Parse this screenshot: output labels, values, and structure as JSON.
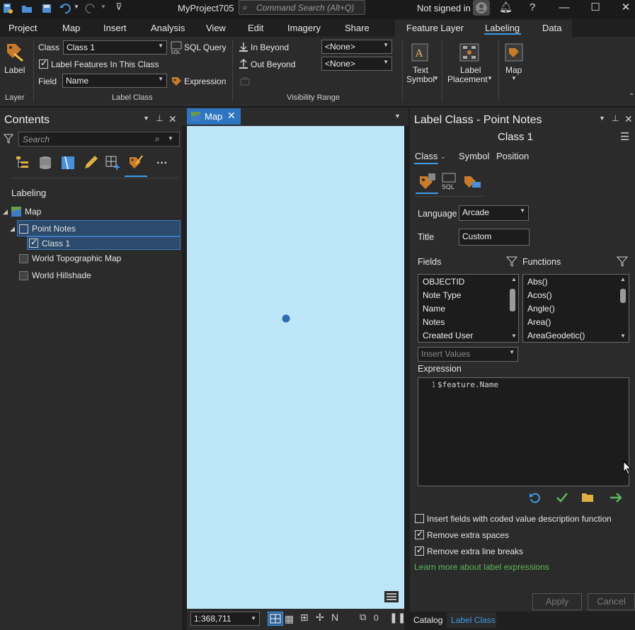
{
  "title_bar": {
    "project_name": "MyProject705",
    "command_search_placeholder": "Command Search (Alt+Q)",
    "sign_in_status": "Not signed in",
    "help_label": "?"
  },
  "menu": {
    "tabs": [
      "Project",
      "Map",
      "Insert",
      "Analysis",
      "View",
      "Edit",
      "Imagery",
      "Share"
    ],
    "contextual_tabs": [
      "Feature Layer",
      "Labeling",
      "Data"
    ],
    "active_tab": "Labeling"
  },
  "ribbon": {
    "layer_group": {
      "label_button": "Label",
      "group_label": "Layer"
    },
    "label_class_group": {
      "class_label": "Class",
      "class_value": "Class 1",
      "sql_query": "SQL Query",
      "label_features_checkbox": "Label Features In This Class",
      "field_label": "Field",
      "field_value": "Name",
      "expression_button": "Expression",
      "group_label": "Label Class"
    },
    "visibility_group": {
      "in_beyond": "In Beyond",
      "out_beyond": "Out Beyond",
      "in_beyond_value": "<None>",
      "out_beyond_value": "<None>",
      "group_label": "Visibility Range"
    },
    "text_symbol": [
      "Text",
      "Symbol"
    ],
    "label_placement": [
      "Label",
      "Placement"
    ],
    "map_button": "Map"
  },
  "contents": {
    "title": "Contents",
    "search_placeholder": "Search",
    "section_heading": "Labeling",
    "tree": {
      "map": "Map",
      "point_notes": "Point Notes",
      "class1": "Class 1",
      "topo": "World Topographic Map",
      "hillshade": "World Hillshade"
    }
  },
  "map_view": {
    "tab_label": "Map",
    "scale": "1:368,711",
    "selected_count": "0"
  },
  "label_class_pane": {
    "title": "Label Class - Point Notes",
    "class_name": "Class 1",
    "subtabs": [
      "Class",
      "Symbol",
      "Position"
    ],
    "language_label": "Language",
    "language_value": "Arcade",
    "title_label": "Title",
    "title_value": "Custom",
    "fields_label": "Fields",
    "functions_label": "Functions",
    "fields": [
      "OBJECTID",
      "Note Type",
      "Name",
      "Notes",
      "Created User"
    ],
    "functions": [
      "Abs()",
      "Acos()",
      "Angle()",
      "Area()",
      "AreaGeodetic()"
    ],
    "insert_values": "Insert Values",
    "expression_label": "Expression",
    "expression_line_number": "1",
    "expression_code": "$feature.Name",
    "options": [
      {
        "label": "Insert fields with coded value description function",
        "checked": false
      },
      {
        "label": "Remove extra spaces",
        "checked": true
      },
      {
        "label": "Remove extra line breaks",
        "checked": true
      }
    ],
    "learn_more_link": "Learn more about label expressions",
    "apply_button": "Apply",
    "cancel_button": "Cancel"
  },
  "bottom_tabs": [
    "Catalog",
    "Label Class"
  ],
  "colors": {
    "accent": "#3c9be8",
    "map_background": "#bee6f9",
    "point": "#2b6cb0",
    "link_green": "#5cb85c"
  }
}
